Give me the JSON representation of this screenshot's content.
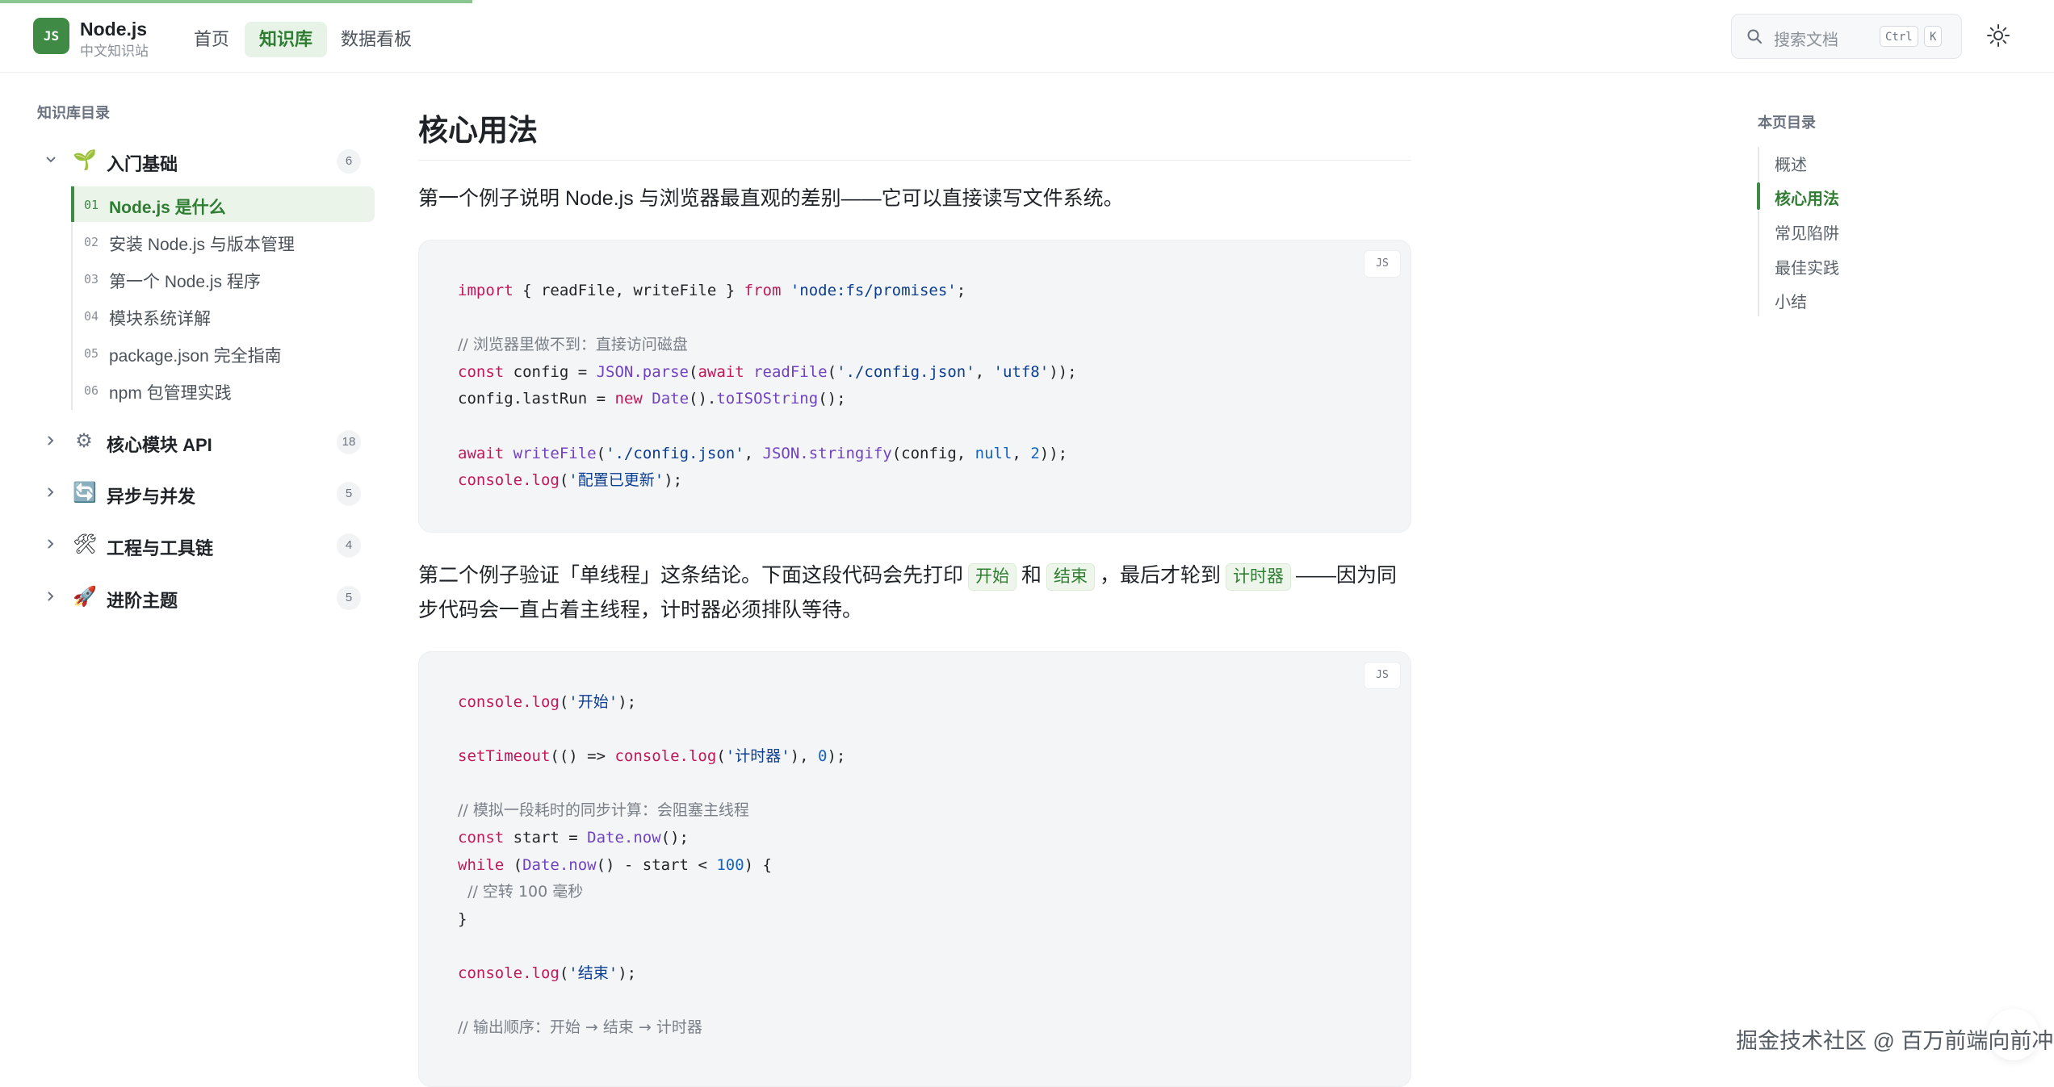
{
  "brand": {
    "badge": "JS",
    "name": "Node.js",
    "subtitle": "中文知识站"
  },
  "nav": [
    {
      "label": "首页",
      "active": false
    },
    {
      "label": "知识库",
      "active": true
    },
    {
      "label": "数据看板",
      "active": false
    }
  ],
  "search": {
    "placeholder": "搜索文档",
    "shortcut_mod": "Ctrl",
    "shortcut_key": "K"
  },
  "sidebar": {
    "title": "知识库目录",
    "groups": [
      {
        "icon": "🌱",
        "label": "入门基础",
        "count": "6",
        "expanded": true,
        "items": [
          {
            "num": "01",
            "label": "Node.js 是什么",
            "active": true
          },
          {
            "num": "02",
            "label": "安装 Node.js 与版本管理"
          },
          {
            "num": "03",
            "label": "第一个 Node.js 程序"
          },
          {
            "num": "04",
            "label": "模块系统详解"
          },
          {
            "num": "05",
            "label": "package.json 完全指南"
          },
          {
            "num": "06",
            "label": "npm 包管理实践"
          }
        ]
      },
      {
        "icon": "⚙",
        "label": "核心模块 API",
        "count": "18"
      },
      {
        "icon": "🔄",
        "label": "异步与并发",
        "count": "5"
      },
      {
        "icon": "🛠",
        "label": "工程与工具链",
        "count": "4"
      },
      {
        "icon": "🚀",
        "label": "进阶主题",
        "count": "5"
      }
    ]
  },
  "main": {
    "heading": "核心用法",
    "para1": "第一个例子说明 Node.js 与浏览器最直观的差别——它可以直接读写文件系统。",
    "code1_lang": "JS",
    "para2": {
      "a": "第二个例子验证「单线程」这条结论。下面这段代码会先打印",
      "code_a": "开始",
      "b": "和",
      "code_b": "结束",
      "c": "，最后才轮到",
      "code_c": "计时器",
      "d": "——因为同步代码会一直占着主线程，计时器必须排队等待。"
    },
    "code2_lang": "JS",
    "code1": {
      "l1": {
        "k1": "import",
        "t1": " { readFile, writeFile } ",
        "k2": "from",
        "t2": " ",
        "s1": "'node:fs/promises'",
        "t3": ";"
      },
      "l3": "// 浏览器里做不到：直接访问磁盘",
      "l4": {
        "k1": "const",
        "t1": " config = ",
        "f1": "JSON.parse",
        "t2": "(",
        "k2": "await",
        "t3": " ",
        "f2": "readFile",
        "t4": "(",
        "s1": "'./config.json'",
        "t5": ", ",
        "s2": "'utf8'",
        "t6": "));"
      },
      "l5": {
        "t1": "config.lastRun = ",
        "k1": "new",
        "t2": " ",
        "f1": "Date",
        "t3": "().",
        "f2": "toISOString",
        "t4": "();"
      },
      "l7": {
        "k1": "await",
        "t1": " ",
        "f1": "writeFile",
        "t2": "(",
        "s1": "'./config.json'",
        "t3": ", ",
        "f2": "JSON.stringify",
        "t4": "(config, ",
        "n1": "null",
        "t5": ", ",
        "n2": "2",
        "t6": "));"
      },
      "l8": {
        "k1": "console.log",
        "t1": "(",
        "s1": "'配置已更新'",
        "t2": ");"
      }
    },
    "code2": {
      "l1": {
        "k1": "console.log",
        "t1": "(",
        "s1": "'开始'",
        "t2": ");"
      },
      "l3": {
        "k1": "setTimeout",
        "t1": "(() => ",
        "k2": "console.log",
        "t2": "(",
        "s1": "'计时器'",
        "t3": "), ",
        "n1": "0",
        "t4": ");"
      },
      "l5": "// 模拟一段耗时的同步计算：会阻塞主线程",
      "l6": {
        "k1": "const",
        "t1": " start = ",
        "f1": "Date.now",
        "t2": "();"
      },
      "l7": {
        "k1": "while",
        "t1": " (",
        "f1": "Date.now",
        "t2": "() - start < ",
        "n1": "100",
        "t3": ") {"
      },
      "l8": "  // 空转 100 毫秒",
      "l9": "}",
      "l11": {
        "k1": "console.log",
        "t1": "(",
        "s1": "'结束'",
        "t2": ");"
      },
      "l13": "// 输出顺序：开始 → 结束 → 计时器"
    }
  },
  "toc": {
    "title": "本页目录",
    "items": [
      {
        "label": "概述"
      },
      {
        "label": "核心用法",
        "active": true
      },
      {
        "label": "常见陷阱"
      },
      {
        "label": "最佳实践"
      },
      {
        "label": "小结"
      }
    ]
  },
  "watermark": "掘金技术社区 @ 百万前端向前冲",
  "colors": {
    "accent": "#3f8a45",
    "accent_bg": "#e8f3e7",
    "code_bg": "#f4f5f6"
  }
}
